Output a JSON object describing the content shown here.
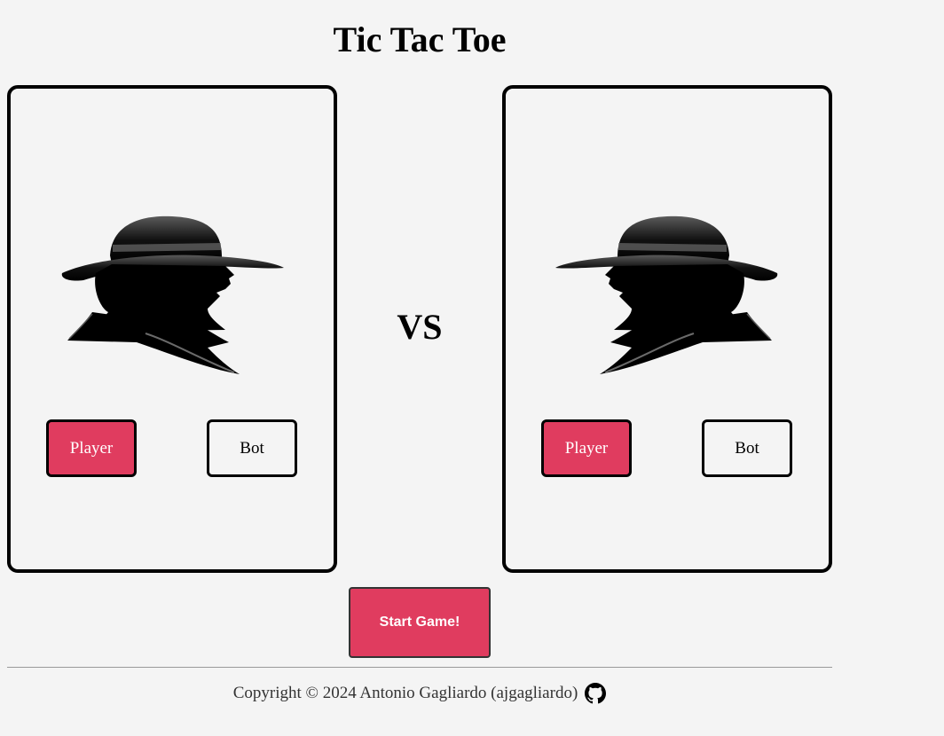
{
  "title": "Tic Tac Toe",
  "vs_label": "VS",
  "players": [
    {
      "avatar_icon": "hat-silhouette-icon",
      "options": {
        "player_label": "Player",
        "bot_label": "Bot"
      },
      "selected": "Player"
    },
    {
      "avatar_icon": "hat-silhouette-icon",
      "options": {
        "player_label": "Player",
        "bot_label": "Bot"
      },
      "selected": "Player"
    }
  ],
  "start_button": "Start Game!",
  "footer": {
    "copyright": "Copyright © 2024 Antonio Gagliardo (ajgagliardo)",
    "link_icon": "github-icon"
  },
  "colors": {
    "accent": "#e03c5f",
    "background": "#f4f4f4",
    "border": "#000000"
  }
}
